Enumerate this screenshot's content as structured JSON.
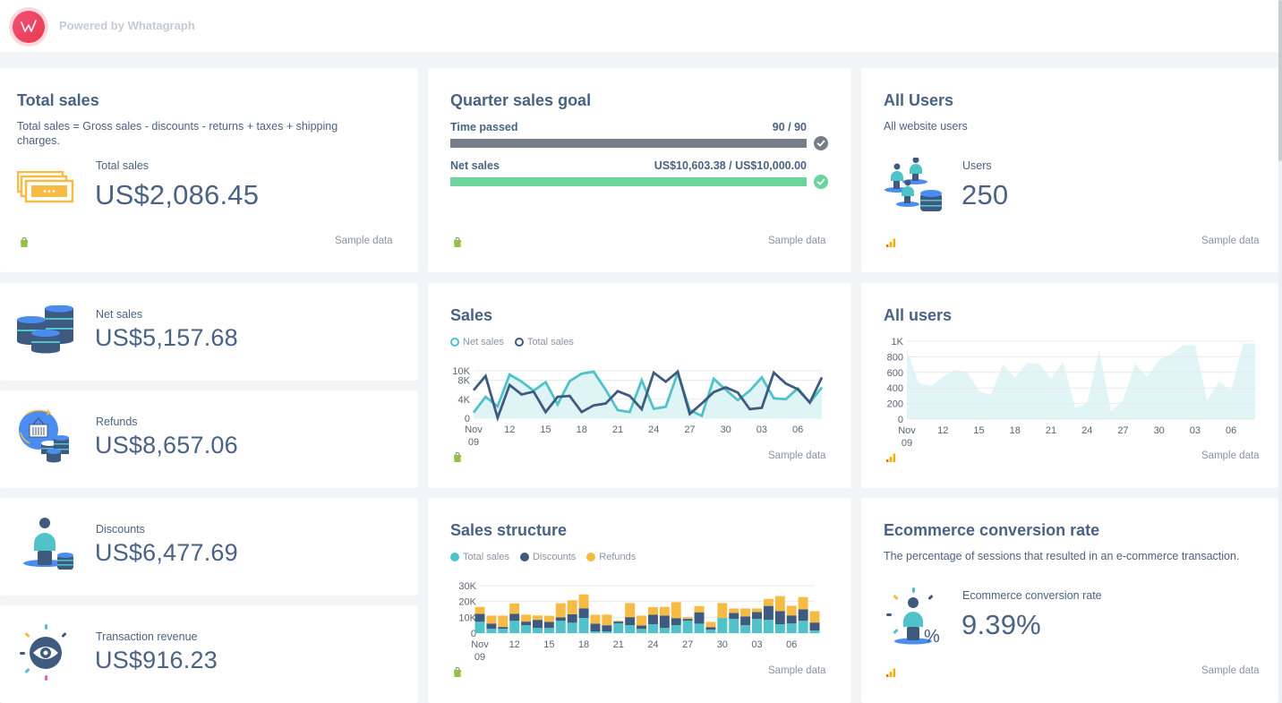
{
  "header": {
    "logo_letter": "W",
    "powered_by": "Powered by Whatagraph"
  },
  "footer_label": "Sample data",
  "cards": {
    "total_sales": {
      "title": "Total sales",
      "description": "Total sales = Gross sales - discounts - returns + taxes + shipping charges.",
      "metric_label": "Total sales",
      "metric_value": "US$2,086.45",
      "icon": "cash-bills-icon",
      "source": "shopify-icon"
    },
    "quarter_goal": {
      "title": "Quarter sales goal",
      "rows": [
        {
          "label": "Time passed",
          "value": "90 / 90",
          "progress": 1.0,
          "color": "#767e8a",
          "status": "complete"
        },
        {
          "label": "Net sales",
          "value": "US$10,603.38 / US$10,000.00",
          "progress": 1.0,
          "color": "#6bd49a",
          "status": "complete"
        }
      ],
      "source": "shopify-icon"
    },
    "all_users_metric": {
      "title": "All Users",
      "description": "All website users",
      "metric_label": "Users",
      "metric_value": "250",
      "icon": "users-database-icon",
      "source": "google-analytics-icon"
    },
    "net_sales": {
      "metric_label": "Net sales",
      "metric_value": "US$5,157.68",
      "icon": "coin-stacks-icon"
    },
    "refunds": {
      "metric_label": "Refunds",
      "metric_value": "US$8,657.06",
      "icon": "refund-basket-icon"
    },
    "discounts": {
      "metric_label": "Discounts",
      "metric_value": "US$6,477.69",
      "icon": "person-coins-icon"
    },
    "transaction_revenue": {
      "metric_label": "Transaction revenue",
      "metric_value": "US$916.23",
      "icon": "eye-icon"
    },
    "sales_chart": {
      "title": "Sales",
      "source": "shopify-icon"
    },
    "all_users_chart": {
      "title": "All users",
      "source": "google-analytics-icon"
    },
    "sales_structure": {
      "title": "Sales structure",
      "source": "shopify-icon"
    },
    "ecommerce": {
      "title": "Ecommerce conversion rate",
      "description": "The percentage of sessions that resulted in an e-commerce transaction.",
      "metric_label": "Ecommerce conversion rate",
      "metric_value": "9.39%",
      "icon": "person-percent-icon",
      "source": "google-analytics-icon"
    }
  },
  "colors": {
    "teal": "#4fc3c9",
    "navy": "#3f5a7f",
    "yellow": "#f6bb45",
    "green": "#6bd49a",
    "gray": "#767e8a"
  },
  "chart_data": [
    {
      "id": "sales",
      "type": "line",
      "title": "Sales",
      "x": [
        "Nov 09",
        "10",
        "11",
        "12",
        "13",
        "14",
        "15",
        "16",
        "17",
        "18",
        "19",
        "20",
        "21",
        "22",
        "23",
        "24",
        "25",
        "26",
        "27",
        "28",
        "29",
        "30",
        "01",
        "02",
        "03",
        "04",
        "05",
        "06",
        "07",
        "08"
      ],
      "tick_labels": [
        "Nov 09",
        "12",
        "15",
        "18",
        "21",
        "24",
        "27",
        "30",
        "03",
        "06"
      ],
      "tick_index": [
        0,
        3,
        6,
        9,
        12,
        15,
        18,
        21,
        24,
        27
      ],
      "yticks": [
        0,
        4000,
        8000,
        10000
      ],
      "ytick_labels": [
        "0",
        "4K",
        "8K",
        "10K"
      ],
      "ylim": [
        0,
        10000
      ],
      "legend": "top-left",
      "series": [
        {
          "name": "Net sales",
          "color": "#4fc3c9",
          "filled": true,
          "values": [
            1200,
            4500,
            2500,
            9200,
            7700,
            5800,
            7600,
            2900,
            7800,
            9400,
            9800,
            6000,
            1700,
            1300,
            8000,
            2000,
            2400,
            9600,
            1700,
            500,
            8300,
            6000,
            3800,
            5800,
            8600,
            4200,
            4000,
            6300,
            3300,
            6500
          ]
        },
        {
          "name": "Total sales",
          "color": "#3f5a7f",
          "filled": false,
          "values": [
            5900,
            8900,
            100,
            7000,
            5000,
            5600,
            1300,
            4500,
            4700,
            1300,
            2700,
            3100,
            5700,
            4700,
            1900,
            9600,
            7700,
            9800,
            900,
            3100,
            5500,
            6500,
            5400,
            1900,
            2200,
            9600,
            7300,
            6100,
            3300,
            8600
          ]
        }
      ]
    },
    {
      "id": "all_users",
      "type": "area",
      "title": "All users",
      "x": [
        "Nov 09",
        "10",
        "11",
        "12",
        "13",
        "14",
        "15",
        "16",
        "17",
        "18",
        "19",
        "20",
        "21",
        "22",
        "23",
        "24",
        "25",
        "26",
        "27",
        "28",
        "29",
        "30",
        "01",
        "02",
        "03",
        "04",
        "05",
        "06",
        "07",
        "08"
      ],
      "tick_labels": [
        "Nov 09",
        "12",
        "15",
        "18",
        "21",
        "24",
        "27",
        "30",
        "03",
        "06"
      ],
      "tick_index": [
        0,
        3,
        6,
        9,
        12,
        15,
        18,
        21,
        24,
        27
      ],
      "yticks": [
        0,
        200,
        400,
        600,
        800,
        1000
      ],
      "ytick_labels": [
        "0",
        "200",
        "400",
        "600",
        "800",
        "1K"
      ],
      "ylim": [
        0,
        1000
      ],
      "series": [
        {
          "name": "Users",
          "color": "#dff4f5",
          "values": [
            890,
            460,
            430,
            540,
            630,
            610,
            360,
            310,
            700,
            530,
            720,
            710,
            520,
            740,
            150,
            200,
            890,
            100,
            240,
            710,
            540,
            760,
            830,
            950,
            950,
            240,
            480,
            370,
            970,
            970
          ]
        }
      ]
    },
    {
      "id": "sales_structure",
      "type": "bar",
      "stacked": true,
      "title": "Sales structure",
      "x": [
        "Nov 09",
        "10",
        "11",
        "12",
        "13",
        "14",
        "15",
        "16",
        "17",
        "18",
        "19",
        "20",
        "21",
        "22",
        "23",
        "24",
        "25",
        "26",
        "27",
        "28",
        "29",
        "30",
        "01",
        "02",
        "03",
        "04",
        "05",
        "06",
        "07",
        "08"
      ],
      "tick_labels": [
        "Nov 09",
        "12",
        "15",
        "18",
        "21",
        "24",
        "27",
        "30",
        "03",
        "06"
      ],
      "tick_index": [
        0,
        3,
        6,
        9,
        12,
        15,
        18,
        21,
        24,
        27
      ],
      "yticks": [
        0,
        10000,
        20000,
        30000
      ],
      "ytick_labels": [
        "0",
        "10K",
        "20K",
        "30K"
      ],
      "ylim": [
        0,
        30000
      ],
      "legend": "top-left",
      "series": [
        {
          "name": "Total sales",
          "color": "#4fc3c9",
          "values": [
            7200,
            2800,
            2800,
            7800,
            5000,
            3300,
            3300,
            7800,
            6600,
            9600,
            1100,
            1100,
            6200,
            5000,
            2700,
            5600,
            3300,
            5000,
            7900,
            6000,
            2200,
            9600,
            9000,
            5000,
            9000,
            8400,
            5600,
            6100,
            7800,
            1700
          ]
        },
        {
          "name": "Discounts",
          "color": "#3f5a7f",
          "values": [
            5000,
            3300,
            1100,
            4400,
            2300,
            5100,
            3800,
            2200,
            5400,
            6100,
            4900,
            3900,
            1100,
            5100,
            2100,
            6000,
            7800,
            4500,
            1100,
            7200,
            1600,
            0,
            3800,
            5600,
            4400,
            8800,
            8400,
            5100,
            7200,
            5000
          ]
        },
        {
          "name": "Refunds",
          "color": "#f6bb45",
          "values": [
            4400,
            5000,
            7200,
            6600,
            4400,
            2800,
            3900,
            8900,
            8800,
            8800,
            5600,
            6700,
            600,
            8900,
            6300,
            4900,
            5500,
            10100,
            1100,
            3900,
            3300,
            9400,
            2800,
            5000,
            2200,
            4400,
            9400,
            6100,
            7800,
            7200
          ]
        }
      ]
    }
  ]
}
